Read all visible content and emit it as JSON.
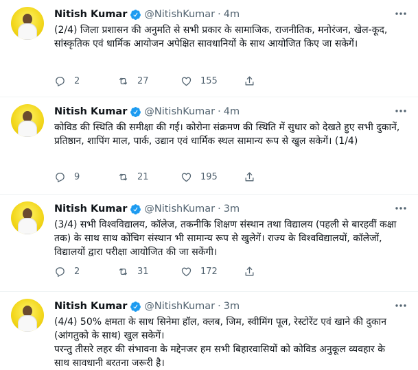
{
  "tweets": [
    {
      "name": "Nitish Kumar",
      "handle": "@NitishKumar",
      "time": "4m",
      "text": "(2/4) जिला प्रशासन की अनुमति से सभी प्रकार के सामाजिक, राजनीतिक, मनोरंजन, खेल-कूद, सांस्कृतिक एवं धार्मिक आयोजन अपेक्षित सावधानियों के साथ आयोजित किए जा सकेगें।",
      "replies": "2",
      "retweets": "27",
      "likes": "155"
    },
    {
      "name": "Nitish Kumar",
      "handle": "@NitishKumar",
      "time": "4m",
      "text": "कोविड की स्थिति की समीक्षा की गई। कोरोना संक्रमण की स्थिति में सुधार को देखते हुए सभी दुकानें, प्रतिष्ठान, शापिंग माल, पार्क, उद्यान एवं धार्मिक स्थल सामान्य रूप से खुल सकेगें। (1/4)",
      "replies": "9",
      "retweets": "21",
      "likes": "195"
    },
    {
      "name": "Nitish Kumar",
      "handle": "@NitishKumar",
      "time": "3m",
      "text": "(3/4) सभी विश्वविद्यालय, कॉलेज, तकनीकि शिक्षण संस्थान तथा विद्यालय (पहली से बारहवीं कक्षा तक) के साथ साथ कोंचिग संस्थान भी सामान्य रूप से खुलेगें। राज्य के विश्वविद्यालयों, कॉलेजों, विद्यालयों द्वारा परीक्षा आयोजित की जा सकेंगी।",
      "replies": "2",
      "retweets": "31",
      "likes": "172"
    },
    {
      "name": "Nitish Kumar",
      "handle": "@NitishKumar",
      "time": "3m",
      "text": "(4/4) 50% क्षमता के साथ सिनेमा हॉल, क्लब, जिम, स्वीमिंग पूल, रेस्टोरेंट एवं खाने की दुकान (आंगतुको के साथ) खुल सकेगें।\nपरन्तु तीसरे लहर की संभावना के मद्देनजर हम सभी बिहारवासियों को कोविड अनुकूल व्यवहार के साथ सावधानी बरतना जरूरी है।",
      "replies": "",
      "retweets": "",
      "likes": ""
    }
  ],
  "colors": {
    "verified": "#1d9bf0",
    "muted": "#536471",
    "divider": "#eff3f4"
  }
}
